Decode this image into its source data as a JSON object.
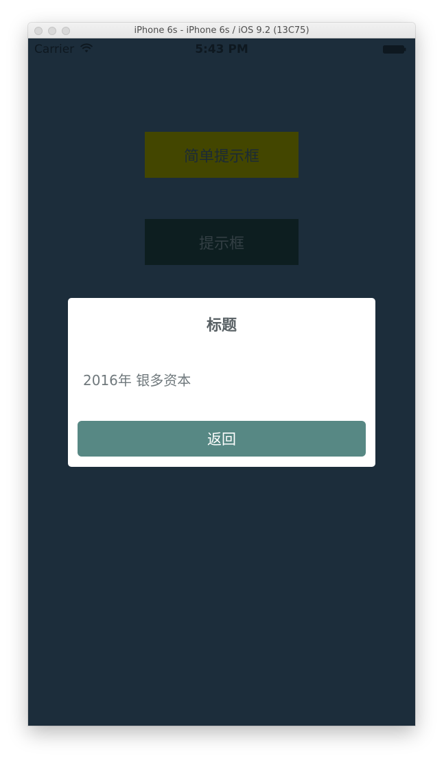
{
  "window": {
    "title": "iPhone 6s - iPhone 6s / iOS 9.2 (13C75)"
  },
  "status_bar": {
    "carrier": "Carrier",
    "time": "5:43 PM",
    "icons": [
      "wifi-icon",
      "battery-icon"
    ]
  },
  "buttons": {
    "simple_alert": "简单提示框",
    "alert": "提示框"
  },
  "dialog": {
    "title": "标题",
    "message": "2016年 银多资本",
    "button": "返回"
  },
  "colors": {
    "screen_background": "#1c2d3b",
    "simple_button_bg": "#434600",
    "alert_button_bg": "#0d1e20",
    "dialog_button_bg": "#578884"
  }
}
